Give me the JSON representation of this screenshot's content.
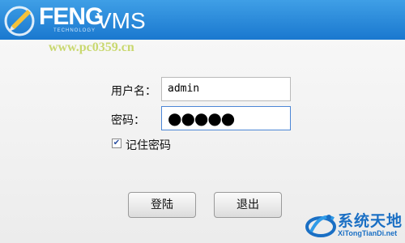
{
  "header": {
    "brand": "FENG",
    "brand_sub": "TECHNOLOGY",
    "product": "VMS"
  },
  "watermark": {
    "url": "www.pc0359.cn"
  },
  "form": {
    "username_label": "用户名：",
    "username_value": "admin",
    "password_label": "密码：",
    "password_mask": "●●●●●",
    "remember_label": "记住密码",
    "remember_checked": true
  },
  "buttons": {
    "login": "登陆",
    "exit": "退出"
  },
  "site_watermark": {
    "name": "系统天地",
    "url": "XiTongTianDi.net"
  },
  "colors": {
    "header": "#2a8ad9",
    "accent": "#1a6fc4"
  }
}
